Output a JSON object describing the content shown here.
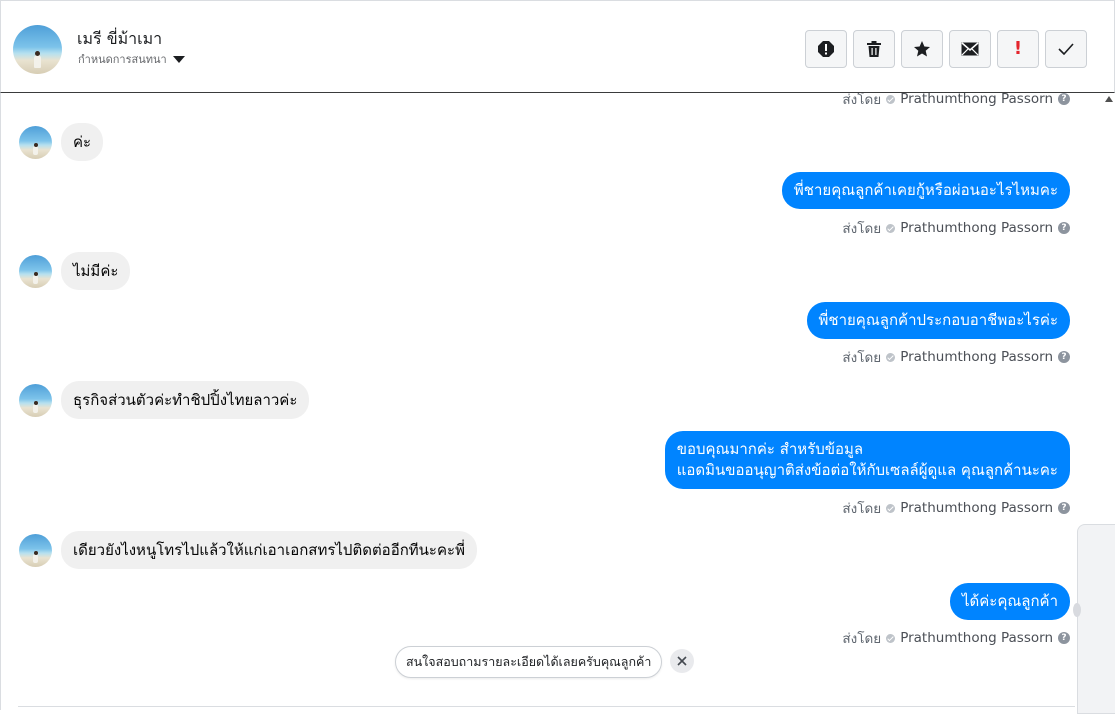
{
  "header": {
    "name": "เมรี ขี่ม้าเมา",
    "subtitle": "กำหนดการสนทนา"
  },
  "actions": [
    {
      "name": "report-icon"
    },
    {
      "name": "trash-icon"
    },
    {
      "name": "star-icon"
    },
    {
      "name": "mail-icon"
    },
    {
      "name": "important-icon",
      "label": "!"
    },
    {
      "name": "check-icon"
    }
  ],
  "sent_by": {
    "prefix": "ส่งโดย",
    "name": "Prathumthong Passorn",
    "help": "?"
  },
  "messages": {
    "in1": "ค่ะ",
    "out1": "พี่ชายคุณลูกค้าเคยกู้หรือผ่อนอะไรไหมคะ",
    "in2": "ไม่มีค่ะ",
    "out2": "พี่ชายคุณลูกค้าประกอบอาชีพอะไรค่ะ",
    "in3": "ธุรกิจส่วนตัวค่ะทำชิปปิ้งไทยลาวค่ะ",
    "out3_line1": "ขอบคุณมากค่ะ สำหรับข้อมูล",
    "out3_line2": "แอดมินขออนุญาติส่งข้อต่อให้กับเซลล์ผู้ดูแล คุณลูกค้านะคะ",
    "in4": "เดียวยังไงหนูโทรไปแล้วให้แก่เอาเอกสทรไปติดต่ออีกทีนะคะพี่",
    "out4": "ได้ค่ะคุณลูกค้า"
  },
  "suggestion": {
    "text": "สนใจสอบถามรายละเอียดได้เลยครับคุณลูกค้า",
    "close": "×"
  },
  "colors": {
    "outgoing_bubble": "#0084ff",
    "incoming_bubble": "#f0f0f0",
    "important": "#e4252c"
  }
}
